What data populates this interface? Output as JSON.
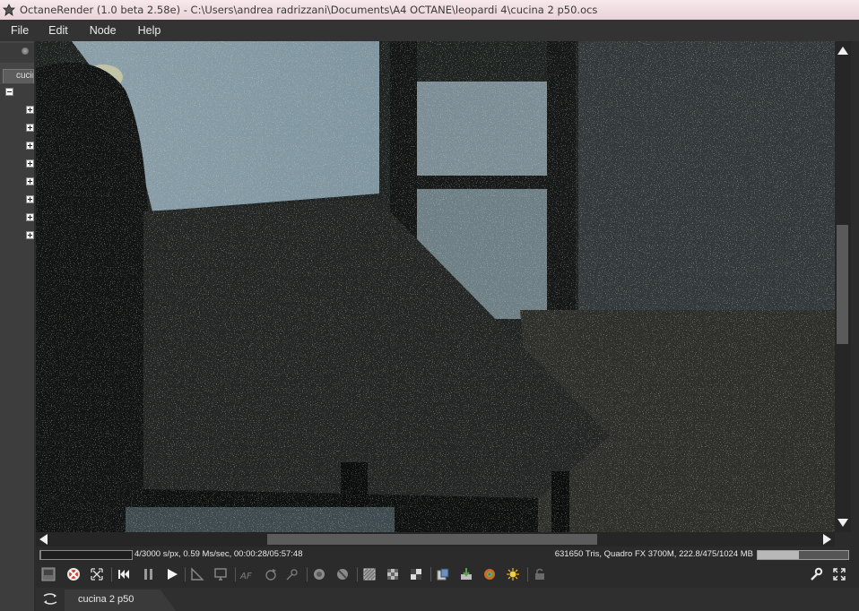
{
  "window": {
    "title": "OctaneRender (1.0 beta 2.58e) - C:\\Users\\andrea radrizzani\\Documents\\A4 OCTANE\\leopardi 4\\cucina 2 p50.ocs"
  },
  "menu": {
    "items": [
      {
        "label": "File"
      },
      {
        "label": "Edit"
      },
      {
        "label": "Node"
      },
      {
        "label": "Help"
      }
    ]
  },
  "left_panel": {
    "tab_label": "cucina"
  },
  "status": {
    "left_text": "4/3000 s/px, 0.59 Ms/sec, 00:00:28/05:57:48",
    "right_text": "631650 Tris, Quadro FX 3700M, 222.8/475/1024 MB",
    "render_progress": 0.0013,
    "memory_used_fraction": 0.46
  },
  "toolbar": {
    "buttons": [
      {
        "icon": "save-render-icon"
      },
      {
        "icon": "clear-render-icon"
      },
      {
        "icon": "fit-view-icon"
      },
      {
        "icon": "restart-render-icon"
      },
      {
        "icon": "pause-icon"
      },
      {
        "icon": "play-icon"
      },
      {
        "icon": "ruler-icon"
      },
      {
        "icon": "monitor-icon"
      },
      {
        "icon": "autofocus-icon"
      },
      {
        "icon": "orbit-icon"
      },
      {
        "icon": "pick-focus-icon"
      },
      {
        "icon": "reset-camera-icon"
      },
      {
        "icon": "recenter-icon"
      },
      {
        "icon": "region-render-icon"
      },
      {
        "icon": "checker-icon"
      },
      {
        "icon": "alpha-icon"
      },
      {
        "icon": "copy-icon"
      },
      {
        "icon": "import-icon"
      },
      {
        "icon": "material-picker-icon"
      },
      {
        "icon": "light-icon"
      },
      {
        "icon": "lock-icon"
      },
      {
        "icon": "wrench-icon"
      },
      {
        "icon": "fullscreen-icon"
      }
    ]
  },
  "bottom_tabs": {
    "items": [
      {
        "label": "cucina 2 p50"
      }
    ]
  }
}
